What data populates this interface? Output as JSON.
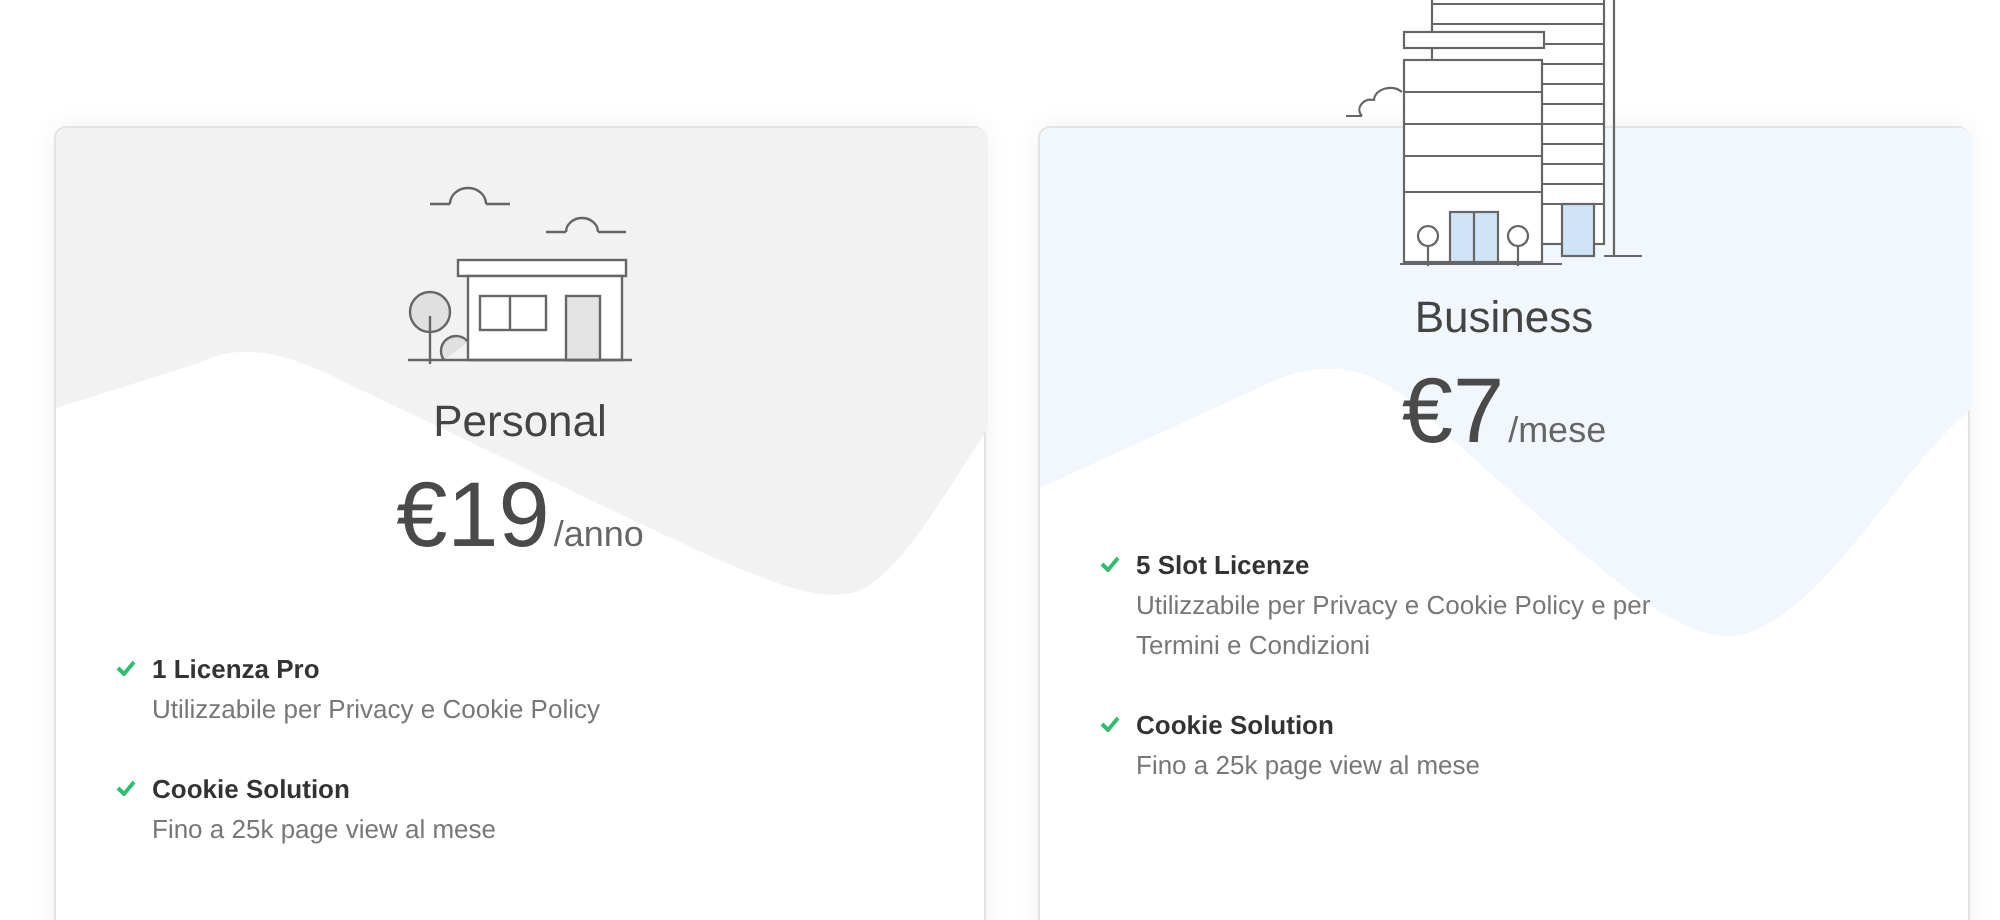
{
  "plans": [
    {
      "kind": "house",
      "name": "Personal",
      "price": "€19",
      "period": "/anno",
      "features": [
        {
          "title": "1 Licenza Pro",
          "description": "Utilizzabile per Privacy e Cookie Policy"
        },
        {
          "title": "Cookie Solution",
          "description": "Fino a 25k page view al mese"
        }
      ]
    },
    {
      "kind": "building",
      "name": "Business",
      "price": "€7",
      "period": "/mese",
      "features": [
        {
          "title": "5 Slot Licenze",
          "description": "Utilizzabile per Privacy e Cookie Policy e per Termini e Condizioni"
        },
        {
          "title": "Cookie Solution",
          "description": "Fino a 25k page view al mese"
        }
      ]
    }
  ]
}
